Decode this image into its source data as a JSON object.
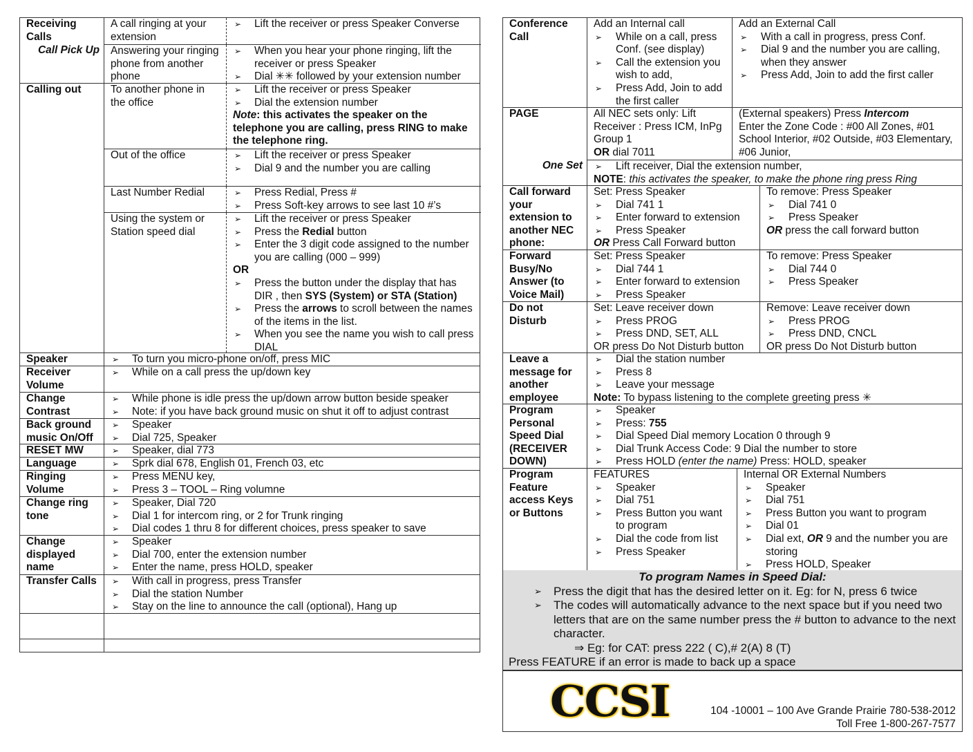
{
  "left": [
    {
      "label": [
        "Receiving Calls"
      ],
      "sub": [
        {
          "cells": [
            [
              {
                "p": [
                  "A call ringing at your extension"
                ]
              }
            ],
            [
              "Lift the receiver or press Speaker Converse"
            ]
          ]
        },
        {
          "label": [
            "Call Pick Up"
          ],
          "cells": [
            [
              {
                "p": [
                  "Answering your ringing phone from another phone"
                ]
              }
            ],
            [
              "When you hear your phone ringing,  lift the receiver  or press Speaker",
              "Dial ✳✳ followed by your extension number"
            ]
          ]
        }
      ]
    },
    {
      "label": [
        "Calling out"
      ],
      "sub": [
        {
          "cells": [
            [
              {
                "p": [
                  "To another phone in the office"
                ]
              }
            ],
            [
              "Lift the receiver or press Speaker",
              "Dial the extension number",
              {
                "p": [
                  {
                    "t": "Note",
                    "f": "bi"
                  },
                  {
                    "t": ": this activates the speaker on the telephone you are calling, press RING to make the telephone ring.",
                    "f": "b"
                  }
                ]
              }
            ]
          ]
        },
        {
          "cells": [
            [
              {
                "p": [
                  "Out of the office"
                ]
              }
            ],
            [
              "Lift the receiver or press Speaker",
              "Dial 9 and the number you are calling"
            ]
          ]
        },
        {
          "cells": [
            [
              {
                "p": [
                  "Last Number Redial"
                ]
              }
            ],
            [
              "Press Redial, Press #",
              "Press Soft-key arrows to see last 10 #’s"
            ]
          ]
        },
        {
          "cells": [
            [
              {
                "p": [
                  "Using the system or Station speed dial"
                ]
              }
            ],
            [
              "Lift the receiver or press Speaker",
              {
                "li": [
                  "Press the ",
                  {
                    "t": "Redial",
                    "f": "b"
                  },
                  " button"
                ]
              },
              "Enter the 3 digit code assigned to the number you are calling (000 – 999)",
              {
                "p": [
                  {
                    "t": "OR",
                    "f": "b"
                  }
                ]
              },
              {
                "li": [
                  "Press the button under the display that has DIR , then ",
                  {
                    "t": "SYS (System) or STA (Station)",
                    "f": "b"
                  }
                ]
              },
              {
                "li": [
                  "Press the ",
                  {
                    "t": "arrows",
                    "f": "b"
                  },
                  " to scroll between the names of the items in the list."
                ]
              },
              "When you see the name you wish to call press DIAL"
            ]
          ]
        }
      ]
    },
    {
      "label": [
        "Speaker"
      ],
      "sub": [
        {
          "cells": [
            [
              "To turn you micro-phone on/off, press MIC"
            ]
          ]
        }
      ]
    },
    {
      "label": [
        "Receiver Volume"
      ],
      "sub": [
        {
          "cells": [
            [
              "While on a call press the up/down key"
            ]
          ]
        }
      ]
    },
    {
      "label": [
        "Change Contrast"
      ],
      "sub": [
        {
          "cells": [
            [
              "While phone is idle press the up/down arrow button beside speaker",
              "Note:  if you have back ground music on shut it off to adjust contrast"
            ]
          ]
        }
      ]
    },
    {
      "label": [
        "Back ground music On/Off"
      ],
      "sub": [
        {
          "cells": [
            [
              "Speaker",
              "Dial 725, Speaker"
            ]
          ]
        }
      ]
    },
    {
      "label": [
        "RESET MW"
      ],
      "sub": [
        {
          "cells": [
            [
              "Speaker, dial 773"
            ]
          ]
        }
      ]
    },
    {
      "label": [
        "Language"
      ],
      "sub": [
        {
          "cells": [
            [
              "Sprk dial 678, English 01, French 03, etc"
            ]
          ]
        }
      ]
    },
    {
      "label": [
        "Ringing Volume"
      ],
      "sub": [
        {
          "cells": [
            [
              "Press MENU key,",
              "Press 3 – TOOL – Ring volumne"
            ]
          ]
        }
      ]
    },
    {
      "label": [
        "Change ring tone"
      ],
      "sub": [
        {
          "cells": [
            [
              "Speaker, Dial 720",
              "Dial 1 for intercom ring, or 2 for Trunk ringing",
              "Dial codes 1 thru 8 for different choices, press speaker to save"
            ]
          ]
        }
      ]
    },
    {
      "label": [
        "Change displayed name"
      ],
      "sub": [
        {
          "cells": [
            [
              "Speaker",
              "Dial 700, enter the extension number",
              "Enter the name, press HOLD, speaker"
            ]
          ]
        }
      ]
    },
    {
      "label": [
        "Transfer Calls"
      ],
      "sub": [
        {
          "cells": [
            [
              "With call in progress, press Transfer",
              "Dial the station Number",
              "Stay on the line to announce the call (optional), Hang up"
            ]
          ]
        }
      ]
    },
    {
      "label": [],
      "sub": [
        {
          "cells": [
            []
          ]
        }
      ]
    },
    {
      "label": [],
      "sub": [
        {
          "cells": [
            []
          ]
        }
      ]
    }
  ],
  "right": [
    {
      "label": [
        "Conference Call"
      ],
      "sub": [
        {
          "cells": [
            [
              {
                "p": [
                  "Add an Internal call"
                ]
              },
              "While on a call, press Conf. (see display)",
              "Call the extension you wish to add,",
              "Press Add, Join to add the first caller"
            ],
            [
              {
                "p": [
                  "Add an External Call"
                ]
              },
              "With a call in progress, press Conf.",
              "Dial 9 and the number you are calling, when they answer",
              "Press Add, Join to add the first caller"
            ]
          ]
        }
      ]
    },
    {
      "label": [
        "PAGE"
      ],
      "sub": [
        {
          "cells": [
            [
              {
                "p": [
                  "All  NEC sets only:  Lift Receiver :   Press ICM, InPg   Group 1"
                ]
              },
              {
                "p": [
                  {
                    "t": "OR",
                    "f": "b"
                  },
                  " dial  7011"
                ]
              }
            ],
            [
              {
                "p": [
                  "(External  speakers)  Press ",
                  {
                    "t": "Intercom",
                    "f": "bi"
                  }
                ]
              },
              {
                "p": [
                  " Enter the Zone Code : #00 All Zones, #01 School Interior, #02 Outside, #03 Elementary, #06 Junior,"
                ]
              }
            ]
          ]
        },
        {
          "label": [
            "One Set"
          ],
          "cells": [
            [
              "Lift receiver,  Dial the extension number,",
              {
                "p": [
                  {
                    "t": "NOTE",
                    "f": "b"
                  },
                  ": ",
                  {
                    "t": "this activates the speaker, to make the phone ring press Ring",
                    "f": "i"
                  }
                ]
              }
            ]
          ]
        }
      ]
    },
    {
      "label": [
        "Call forward your extension to another  NEC phone:"
      ],
      "sub": [
        {
          "cells": [
            [
              {
                "p": [
                  "Set: Press Speaker"
                ]
              },
              "Dial 741  1",
              "Enter forward to extension",
              "Press Speaker",
              {
                "p": [
                  {
                    "t": "OR",
                    "f": "bi"
                  },
                  " Press Call Forward button"
                ]
              }
            ],
            [
              {
                "p": [
                  "To remove: Press Speaker"
                ]
              },
              "Dial 741  0",
              "Press Speaker",
              {
                "p": [
                  {
                    "t": "OR",
                    "f": "bi"
                  },
                  " press the call forward button"
                ]
              }
            ]
          ]
        }
      ]
    },
    {
      "label": [
        "Forward Busy/No Answer (to Voice Mail)"
      ],
      "sub": [
        {
          "cells": [
            [
              {
                "p": [
                  "Set: Press Speaker"
                ]
              },
              "Dial 744  1",
              "Enter forward to extension",
              "Press Speaker"
            ],
            [
              {
                "p": [
                  "To remove: Press Speaker"
                ]
              },
              "Dial 744  0",
              "Press Speaker"
            ]
          ]
        }
      ]
    },
    {
      "label": [
        "Do not Disturb"
      ],
      "sub": [
        {
          "cells": [
            [
              {
                "p": [
                  "Set:  Leave receiver down"
                ]
              },
              "Press PROG",
              "Press DND, SET, ALL",
              {
                "p": [
                  "OR press Do Not Disturb button"
                ]
              }
            ],
            [
              {
                "p": [
                  "Remove: Leave receiver down"
                ]
              },
              "Press PROG",
              "Press DND, CNCL",
              {
                "p": [
                  "OR press Do Not Disturb button"
                ]
              }
            ]
          ]
        }
      ]
    },
    {
      "label": [
        "Leave a message for another employee"
      ],
      "sub": [
        {
          "cells": [
            [
              "Dial the station number",
              "Press 8",
              "Leave your message",
              {
                "p": [
                  {
                    "t": "Note:",
                    "f": "b"
                  },
                  "  To bypass listening to the complete greeting press ✳"
                ]
              }
            ]
          ]
        }
      ]
    },
    {
      "label": [
        "Program Personal Speed Dial (RECEIVER DOWN)"
      ],
      "sub": [
        {
          "cells": [
            [
              "Speaker",
              {
                "li": [
                  "Press:  ",
                  {
                    "t": "755",
                    "f": "b"
                  }
                ]
              },
              "Dial Speed Dial memory Location 0 through 9",
              "Dial Trunk Access Code:  9 Dial the number to store",
              {
                "li": [
                  "Press HOLD ",
                  {
                    "t": "(enter  the name)",
                    "f": "i"
                  },
                  " Press:  HOLD, speaker"
                ]
              }
            ]
          ]
        }
      ]
    },
    {
      "label": [
        "Program Feature access Keys or Buttons"
      ],
      "sub": [
        {
          "cells": [
            [
              {
                "p": [
                  "FEATURES"
                ]
              },
              "Speaker",
              "Dial 751",
              "Press Button you want to program",
              "Dial the code from list",
              "Press Speaker"
            ],
            [
              {
                "p": [
                  "Internal  OR External Numbers"
                ]
              },
              "Speaker",
              "Dial 751",
              "Press Button you want to program",
              "Dial   01",
              {
                "li": [
                  "Dial ext, ",
                  {
                    "t": "OR",
                    "f": "bi"
                  },
                  "  9 and the number you are storing"
                ]
              },
              "Press HOLD, Speaker"
            ]
          ]
        }
      ]
    }
  ],
  "speed_names": {
    "title": "To program  Names in Speed Dial:",
    "items": [
      "Press the digit that has the desired letter on it. Eg:  for N, press 6 twice",
      "The codes will automatically advance to the next space but if you need two letters that are on the same number press the # button to advance to the next character."
    ],
    "example": "⇒  Eg:  for CAT:  press 222 ( C),# 2(A) 8 (T)",
    "footer_note": "Press FEATURE if an error is made to back up a space",
    "background": "#dedede"
  },
  "footer": {
    "logo_text": "CCSI",
    "logo_colors": {
      "text": "#111111",
      "glow": "#f2c200"
    },
    "address": "104 -10001 – 100 Ave Grande Prairie  780-538-2012",
    "toll_free": "Toll Free 1-800-267-7577"
  }
}
